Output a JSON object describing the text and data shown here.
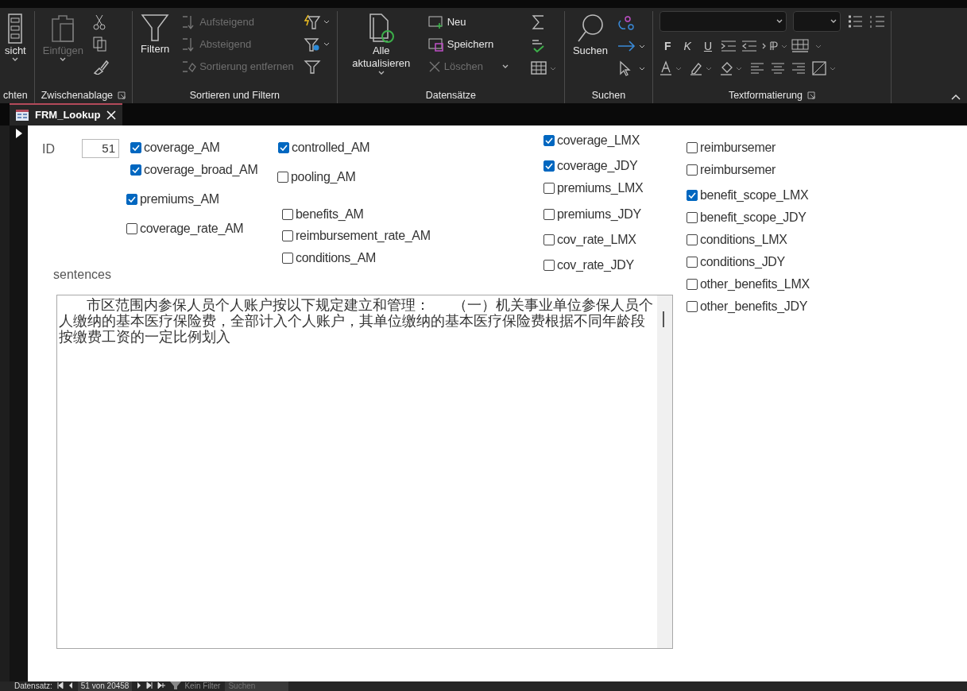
{
  "ribbon": {
    "groups": [
      {
        "label": "chten",
        "commands": [
          {
            "label": "sicht",
            "kind": "large",
            "disabled": false,
            "dropdown": true
          }
        ]
      },
      {
        "label": "Zwischenablage",
        "launcher": true,
        "commands": [
          {
            "label": "Einfügen",
            "kind": "large",
            "disabled": true,
            "dropdown": true
          }
        ]
      },
      {
        "label": "Sortieren und Filtern",
        "commands": [
          {
            "label": "Filtern",
            "kind": "large",
            "disabled": false
          },
          {
            "label": "Aufsteigend",
            "kind": "small",
            "disabled": true
          },
          {
            "label": "Absteigend",
            "kind": "small",
            "disabled": true
          },
          {
            "label": "Sortierung entfernen",
            "kind": "small",
            "disabled": true
          }
        ]
      },
      {
        "label": "Datensätze",
        "commands": [
          {
            "label": "Alle aktualisieren",
            "kind": "large",
            "disabled": false,
            "dropdown": true
          },
          {
            "label": "Neu",
            "kind": "small",
            "disabled": false
          },
          {
            "label": "Speichern",
            "kind": "small",
            "disabled": false
          },
          {
            "label": "Löschen",
            "kind": "small",
            "disabled": true,
            "dropdown": true
          }
        ]
      },
      {
        "label": "Suchen",
        "commands": [
          {
            "label": "Suchen",
            "kind": "large",
            "disabled": false
          }
        ]
      },
      {
        "label": "Textformatierung",
        "launcher": true,
        "commands": [
          {
            "label": "F",
            "kind": "format",
            "disabled": false
          },
          {
            "label": "K",
            "kind": "format",
            "disabled": false
          },
          {
            "label": "U",
            "kind": "format",
            "disabled": false
          }
        ]
      }
    ]
  },
  "tabs": [
    {
      "label": "FRM_Lookup",
      "selected": true
    }
  ],
  "form": {
    "id_label": "ID",
    "id_value": "51",
    "sentences_label": "sentences",
    "sentences": "       市区范围内参保人员个人账户按以下规定建立和管理：      （一）机关事业单位参保人员个人缴纳的基本医疗保险费，全部计入个人账户，其单位缴纳的基本医疗保险费根据不同年龄段按缴费工资的一定比例划入",
    "checkboxes": [
      {
        "label": "coverage_AM",
        "checked": true
      },
      {
        "label": "coverage_broad_AM",
        "checked": true
      },
      {
        "label": "premiums_AM",
        "checked": true
      },
      {
        "label": "coverage_rate_AM",
        "checked": false
      },
      {
        "label": "controlled_AM",
        "checked": true
      },
      {
        "label": "pooling_AM",
        "checked": false
      },
      {
        "label": "benefits_AM",
        "checked": false
      },
      {
        "label": "reimbursement_rate_AM",
        "checked": false
      },
      {
        "label": "conditions_AM",
        "checked": false
      },
      {
        "label": "coverage_LMX",
        "checked": true
      },
      {
        "label": "coverage_JDY",
        "checked": true
      },
      {
        "label": "premiums_LMX",
        "checked": false
      },
      {
        "label": "premiums_JDY",
        "checked": false
      },
      {
        "label": "cov_rate_LMX",
        "checked": false
      },
      {
        "label": "cov_rate_JDY",
        "checked": false
      },
      {
        "label": "reimbursemer",
        "checked": false
      },
      {
        "label": "reimbursemer",
        "checked": false
      },
      {
        "label": "benefit_scope_LMX",
        "checked": true
      },
      {
        "label": "benefit_scope_JDY",
        "checked": false
      },
      {
        "label": "conditions_LMX",
        "checked": false
      },
      {
        "label": "conditions_JDY",
        "checked": false
      },
      {
        "label": "other_benefits_LMX",
        "checked": false
      },
      {
        "label": "other_benefits_JDY",
        "checked": false
      }
    ]
  },
  "status_bar": {
    "label": "Datensatz:",
    "record": "51 von 20458",
    "filter": "Kein Filter",
    "search_placeholder": "Suchen"
  }
}
